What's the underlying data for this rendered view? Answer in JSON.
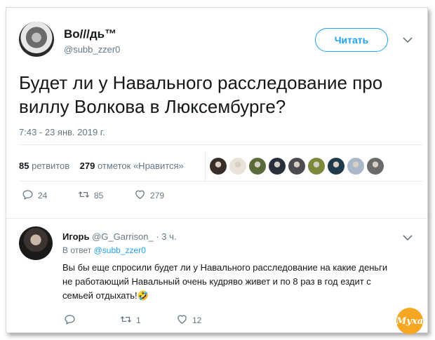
{
  "tweet": {
    "author_name": "Во///дь™",
    "author_handle": "@subb_zzer0",
    "follow_label": "Читать",
    "text": "Будет ли у Навального расследование про виллу Волкова в Люксембурге?",
    "timestamp": "7:43 - 23 янв. 2019 г.",
    "retweets_count": "85",
    "retweets_label": "ретвитов",
    "likes_count": "279",
    "likes_label": "отметок «Нравится»",
    "actions": {
      "replies": "24",
      "retweets": "85",
      "likes": "279"
    }
  },
  "likers_colors": [
    "#3a2f28",
    "#e9e2d8",
    "#5b6b3a",
    "#2a2f3c",
    "#4d4a52",
    "#7a8a3a",
    "#1f3a4a",
    "#a8b8c8",
    "#6a6a6a"
  ],
  "reply": {
    "author_name": "Игорь",
    "author_handle": "@G_Garrison_",
    "time": "· 3 ч.",
    "in_reply_prefix": "В ответ",
    "in_reply_handle": "@subb_zzer0",
    "text": "Вы бы еще спросили будет ли у Навального расследование на какие деньги не работающий Навальный очень кудряво живет и по 8 раз в год ездит с семьей отдыхать!🤣",
    "actions": {
      "replies": "",
      "retweets": "1",
      "likes": "12"
    }
  },
  "watermark": "Муха",
  "colors": {
    "accent": "#1da1f2",
    "muted": "#657786"
  },
  "icons": [
    "reply-icon",
    "retweet-icon",
    "heart-icon",
    "chevron-down-icon"
  ]
}
